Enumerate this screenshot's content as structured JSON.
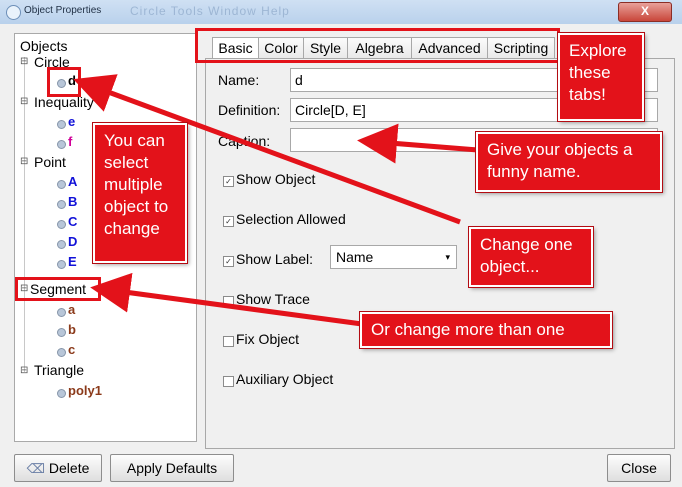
{
  "window": {
    "title": "Object Properties",
    "title_ghost": "Circle Tools Window Help",
    "close_symbol": "X"
  },
  "tree": {
    "root": "Objects",
    "groups": [
      {
        "label": "Circle",
        "items": [
          {
            "label": "d",
            "color": "#000000"
          }
        ]
      },
      {
        "label": "Inequality",
        "items": [
          {
            "label": "e",
            "color": "#1111d8"
          },
          {
            "label": "f",
            "color": "#d00098"
          }
        ]
      },
      {
        "label": "Point",
        "items": [
          {
            "label": "A",
            "color": "#1111d8"
          },
          {
            "label": "B",
            "color": "#1111d8"
          },
          {
            "label": "C",
            "color": "#1111d8"
          },
          {
            "label": "D",
            "color": "#1111d8"
          },
          {
            "label": "E",
            "color": "#1111d8"
          }
        ]
      },
      {
        "label": "Segment",
        "items": [
          {
            "label": "a",
            "color": "#8b3a1a"
          },
          {
            "label": "b",
            "color": "#8b3a1a"
          },
          {
            "label": "c",
            "color": "#8b3a1a"
          }
        ]
      },
      {
        "label": "Triangle",
        "items": [
          {
            "label": "poly1",
            "color": "#8b3a1a"
          }
        ]
      }
    ]
  },
  "tabs": [
    "Basic",
    "Color",
    "Style",
    "Algebra",
    "Advanced",
    "Scripting"
  ],
  "basic": {
    "name_label": "Name:",
    "name_value": "d",
    "definition_label": "Definition:",
    "definition_value": "Circle[D, E]",
    "caption_label": "Caption:",
    "caption_value": "",
    "show_object": {
      "label": "Show Object",
      "checked": true
    },
    "selection_allowed": {
      "label": "Selection Allowed",
      "checked": true
    },
    "show_label": {
      "label": "Show Label:",
      "checked": true,
      "select_value": "Name"
    },
    "show_trace": {
      "label": "Show Trace",
      "checked": false
    },
    "fix_object": {
      "label": "Fix Object",
      "checked": false
    },
    "auxiliary_object": {
      "label": "Auxiliary Object",
      "checked": false
    }
  },
  "buttons": {
    "delete": "Delete",
    "apply_defaults": "Apply Defaults",
    "close": "Close"
  },
  "annotations": {
    "explore_line1": "Explore",
    "explore_line2": "these",
    "explore_line3": "tabs!",
    "select_line1": "You can",
    "select_line2": "select",
    "select_line3": "multiple",
    "select_line4": "object to",
    "select_line5": "change",
    "funny_line1": "Give your objects a",
    "funny_line2": "funny name.",
    "change_one_line1": "Change one",
    "change_one_line2": "object...",
    "change_more": "Or change more than one"
  },
  "colors": {
    "annotation_red": "#e3121a",
    "blue_item": "#1111d8",
    "brown_item": "#8b3a1a",
    "pink_item": "#d00098"
  }
}
